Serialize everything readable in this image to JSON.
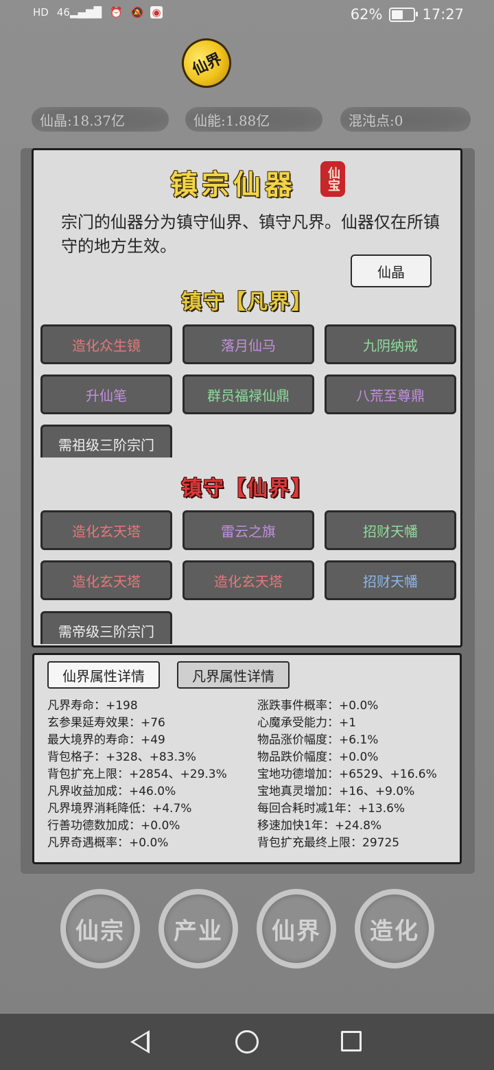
{
  "status_bar": {
    "icons": [
      "hd-icon",
      "signal-icon",
      "alarm-icon",
      "mute-icon",
      "app-notification-icon"
    ],
    "signal_text": "46",
    "battery_percent": "62%",
    "battery_level": 0.62,
    "time": "17:27"
  },
  "logo": {
    "text": "仙界"
  },
  "resources": {
    "crystal": "仙晶:18.37亿",
    "energy": "仙能:1.88亿",
    "chaos": "混沌点:0"
  },
  "panel": {
    "title": "镇宗仙器",
    "seal": "仙宝",
    "description": "宗门的仙器分为镇守仙界、镇守凡界。仙器仅在所镇守的地方生效。",
    "currency_button": "仙晶",
    "mortal_section": {
      "title": "镇守【凡界】",
      "items": [
        {
          "label": "造化众生镜",
          "color": "#e8777a"
        },
        {
          "label": "落月仙马",
          "color": "#c38ee0"
        },
        {
          "label": "九阴纳戒",
          "color": "#8fdc9a"
        },
        {
          "label": "升仙笔",
          "color": "#c38ee0"
        },
        {
          "label": "群员福禄仙鼎",
          "color": "#8fdc9a"
        },
        {
          "label": "八荒至尊鼎",
          "color": "#c38ee0"
        }
      ],
      "requirement": "需祖级三阶宗门"
    },
    "immortal_section": {
      "title": "镇守【仙界】",
      "items": [
        {
          "label": "造化玄天塔",
          "color": "#e8777a"
        },
        {
          "label": "雷云之旗",
          "color": "#c38ee0"
        },
        {
          "label": "招财天幡",
          "color": "#8fdc9a"
        },
        {
          "label": "造化玄天塔",
          "color": "#e8777a"
        },
        {
          "label": "造化玄天塔",
          "color": "#e8777a"
        },
        {
          "label": "招财天幡",
          "color": "#8ab6ec"
        }
      ],
      "requirement": "需帝级三阶宗门"
    }
  },
  "attributes": {
    "tabs": [
      "仙界属性详情",
      "凡界属性详情"
    ],
    "active_tab": 0,
    "left": [
      "凡界寿命：+198",
      "玄参果延寿效果：+76",
      "最大境界的寿命：+49",
      "背包格子：+328、+83.3%",
      "背包扩充上限：+2854、+29.3%",
      "凡界收益加成：+46.0%",
      "凡界境界消耗降低：+4.7%",
      "行善功德数加成：+0.0%",
      "凡界奇遇概率：+0.0%"
    ],
    "right": [
      "涨跌事件概率：+0.0%",
      "心魔承受能力：+1",
      "物品涨价幅度：+6.1%",
      "物品跌价幅度：+0.0%",
      "宝地功德增加：+6529、+16.6%",
      "宝地真灵增加：+16、+9.0%",
      "每回合耗时减1年：+13.6%",
      "移速加快1年：+24.8%",
      "背包扩充最终上限：29725"
    ]
  },
  "bottom_nav": [
    "仙宗",
    "产业",
    "仙界",
    "造化"
  ],
  "system_nav": [
    "back-icon",
    "home-icon",
    "recent-apps-icon"
  ]
}
